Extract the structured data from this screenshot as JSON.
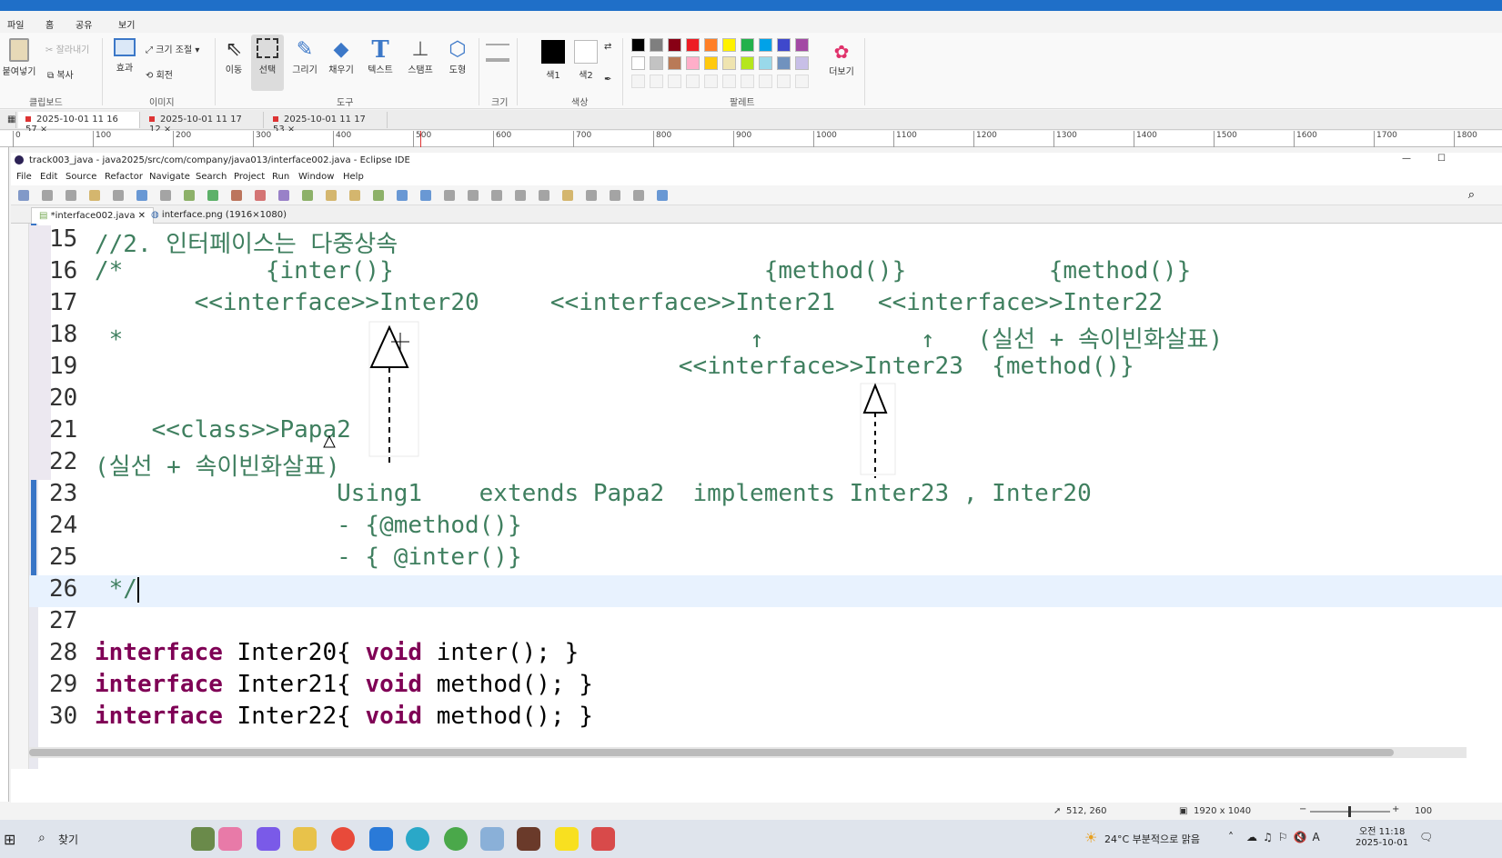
{
  "paint": {
    "tabs": [
      "파일",
      "홈",
      "공유",
      "보기"
    ],
    "clipboard": {
      "paste": "붙여넣기",
      "cut": "잘라내기",
      "copy": "복사",
      "group": "클립보드"
    },
    "image": {
      "effects": "효과",
      "resize": "크기 조절",
      "rotate": "회전",
      "group": "이미지"
    },
    "tools": {
      "move": "이동",
      "select": "선택",
      "draw": "그리기",
      "fill": "채우기",
      "text": "텍스트",
      "stamp": "스탬프",
      "shape": "도형",
      "group": "도구"
    },
    "size": {
      "label": "크기"
    },
    "color": {
      "color1": "색1",
      "color2": "색2",
      "group": "색상"
    },
    "palette": {
      "group": "팔레트",
      "more": "더보기"
    },
    "image_tabs": [
      "2025-10-01 11 16 57",
      "2025-10-01 11 17 12",
      "2025-10-01 11 17 53"
    ],
    "ruler_marks": [
      "0",
      "100",
      "200",
      "300",
      "400",
      "500",
      "600",
      "700",
      "800",
      "900",
      "1000",
      "1100",
      "1200",
      "1300",
      "1400",
      "1500",
      "1600",
      "1700",
      "1800"
    ],
    "status": {
      "cursor": "512, 260",
      "dims": "1920 x 1040",
      "zoom": "100"
    },
    "palette_colors": [
      "#000000",
      "#7f7f7f",
      "#880015",
      "#ed1c24",
      "#ff7f27",
      "#fff200",
      "#22b14c",
      "#00a2e8",
      "#3f48cc",
      "#a349a4",
      "#ffffff",
      "#c3c3c3",
      "#b97a57",
      "#ffaec9",
      "#ffc90e",
      "#efe4b0",
      "#b5e61d",
      "#99d9ea",
      "#7092be",
      "#c8bfe7"
    ]
  },
  "eclipse": {
    "title": "track003_java - java2025/src/com/company/java013/interface002.java - Eclipse IDE",
    "menu": [
      "File",
      "Edit",
      "Source",
      "Refactor",
      "Navigate",
      "Search",
      "Project",
      "Run",
      "Window",
      "Help"
    ],
    "editor_tabs": [
      "*interface002.java",
      "interface.png (1916×1080)"
    ],
    "lines": [
      {
        "n": "15",
        "t": "//2. 인터페이스는 다중상속"
      },
      {
        "n": "16",
        "t": "/*          {inter()}                          {method()}          {method()}"
      },
      {
        "n": "17",
        "t": "       <<interface>>Inter20     <<interface>>Inter21   <<interface>>Inter22"
      },
      {
        "n": "18",
        "t": " *                                            ↑           ↑   (실선 + 속이빈화살표)"
      },
      {
        "n": "19",
        "t": "                                         <<interface>>Inter23  {method()}"
      },
      {
        "n": "20",
        "t": ""
      },
      {
        "n": "21",
        "t": "    <<class>>Papa2"
      },
      {
        "n": "22",
        "t": "(실선 + 속이빈화살표)"
      },
      {
        "n": "23",
        "t": "                 Using1    extends Papa2  implements Inter23 , Inter20"
      },
      {
        "n": "24",
        "t": "                 - {@method()}"
      },
      {
        "n": "25",
        "t": "                 - { @inter()}"
      },
      {
        "n": "26",
        "t": " */"
      },
      {
        "n": "27",
        "t": ""
      },
      {
        "n": "28",
        "k": "interface",
        "t": " Inter20{ ",
        "k2": "void",
        "t2": " inter(); }"
      },
      {
        "n": "29",
        "k": "interface",
        "t": " Inter21{ ",
        "k2": "void",
        "t2": " method(); }"
      },
      {
        "n": "30",
        "k": "interface",
        "t": " Inter22{ ",
        "k2": "void",
        "t2": " method(); }"
      }
    ]
  },
  "taskbar": {
    "search": "찾기",
    "weather": "24°C 부분적으로 맑음",
    "time": "오전 11:18",
    "date": "2025-10-01"
  }
}
